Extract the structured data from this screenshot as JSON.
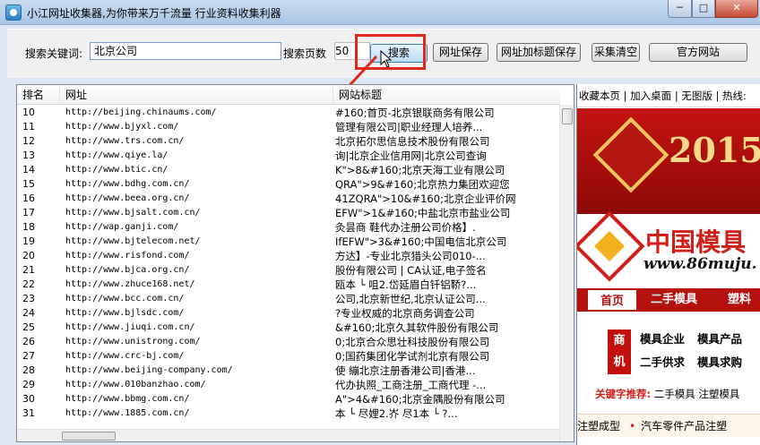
{
  "window": {
    "title": "小江网址收集器,为你带来万千流量 行业资料收集利器",
    "min_label": "─",
    "max_label": "□",
    "close_label": "✕"
  },
  "toolbar": {
    "keyword_label": "搜索关键词:",
    "keyword_value": "北京公司",
    "pages_label": "搜索页数",
    "pages_value": "50",
    "search_label": "搜索",
    "save_label": "网址保存",
    "save_title_label": "网址加标题保存",
    "clear_label": "采集清空",
    "official_label": "官方网站"
  },
  "table": {
    "headers": [
      "排名",
      "网址",
      "网站标题"
    ],
    "rows": [
      {
        "rank": "10",
        "url": "http://beijing.chinaums.com/",
        "title": "#160;首页-北京银联商务有限公司"
      },
      {
        "rank": "11",
        "url": "http://www.bjyxl.com/",
        "title": "管理有限公司|职业经理人培养..."
      },
      {
        "rank": "12",
        "url": "http://www.trs.com.cn/",
        "title": "北京拓尔思信息技术股份有限公司"
      },
      {
        "rank": "13",
        "url": "http://www.qiye.la/",
        "title": "询|北京企业信用网|北京公司查询"
      },
      {
        "rank": "14",
        "url": "http://www.btic.cn/",
        "title": "K\">8&#160;北京天海工业有限公司"
      },
      {
        "rank": "15",
        "url": "http://www.bdhg.com.cn/",
        "title": "QRA\">9&#160;北京热力集团欢迎您"
      },
      {
        "rank": "16",
        "url": "http://www.beea.org.cn/",
        "title": "41ZQRA\">10&#160;北京企业评价网"
      },
      {
        "rank": "17",
        "url": "http://www.bjsalt.com.cn/",
        "title": "EFW\">1&#160;中盐北京市盐业公司"
      },
      {
        "rank": "18",
        "url": "http://wap.ganji.com/",
        "title": "灸昙商  鞋代办注册公司价格】."
      },
      {
        "rank": "19",
        "url": "http://www.bjtelecom.net/",
        "title": "IfEFW\">3&#160;中国电信北京公司"
      },
      {
        "rank": "20",
        "url": "http://www.risfond.com/",
        "title": "方达】-专业北京猎头公司010-..."
      },
      {
        "rank": "21",
        "url": "http://www.bjca.org.cn/",
        "title": "股份有限公司 | CA认证,电子签名"
      },
      {
        "rank": "22",
        "url": "http://www.zhuce168.net/",
        "title": "瓯本 └  咀2.岱延眉白钎铝鞒?..."
      },
      {
        "rank": "23",
        "url": "http://www.bcc.com.cn/",
        "title": "公司,北京新世纪,北京认证公司..."
      },
      {
        "rank": "24",
        "url": "http://www.bjlsdc.com/",
        "title": "?专业权威的北京商务调查公司"
      },
      {
        "rank": "25",
        "url": "http://www.jiuqi.com.cn/",
        "title": "&#160;北京久其软件股份有限公司"
      },
      {
        "rank": "26",
        "url": "http://www.unistrong.com/",
        "title": "0;北京合众思壮科技股份有限公司"
      },
      {
        "rank": "27",
        "url": "http://www.crc-bj.com/",
        "title": "0;国药集团化学试剂北京有限公司"
      },
      {
        "rank": "28",
        "url": "http://www.beijing-company.com/",
        "title": "使  繃北京注册香港公司|香港..."
      },
      {
        "rank": "29",
        "url": "http://www.010banzhao.com/",
        "title": "代办执照_工商注册_工商代理 -..."
      },
      {
        "rank": "30",
        "url": "http://www.bbmg.com.cn/",
        "title": "A\">4&#160;北京金隅股份有限公司"
      },
      {
        "rank": "31",
        "url": "http://www.1885.com.cn/",
        "title": "本 └  尽娌2.岕  尽1本 └  ?..."
      }
    ]
  },
  "webpanel": {
    "top_links": "收藏本页 | 加入桌面 | 无图版 | 热线:",
    "banner_year": "2015",
    "logo_cn": "中国模具",
    "logo_url": "www.86muju.",
    "nav": [
      "首页",
      "二手模具",
      "塑料"
    ],
    "tag": [
      "商",
      "机"
    ],
    "links": [
      "模具企业",
      "模具产品",
      "二手供求",
      "模具求购"
    ],
    "keyword_label": "关键字推荐:",
    "keyword_items": "二手模具  注塑模具",
    "bottom_left": "注塑成型",
    "bottom_right": "汽车零件产品注塑"
  },
  "colors": {
    "annotation_red": "#e1281c",
    "site_red": "#c4100d",
    "title_gradient_top": "#c9dcf0"
  }
}
